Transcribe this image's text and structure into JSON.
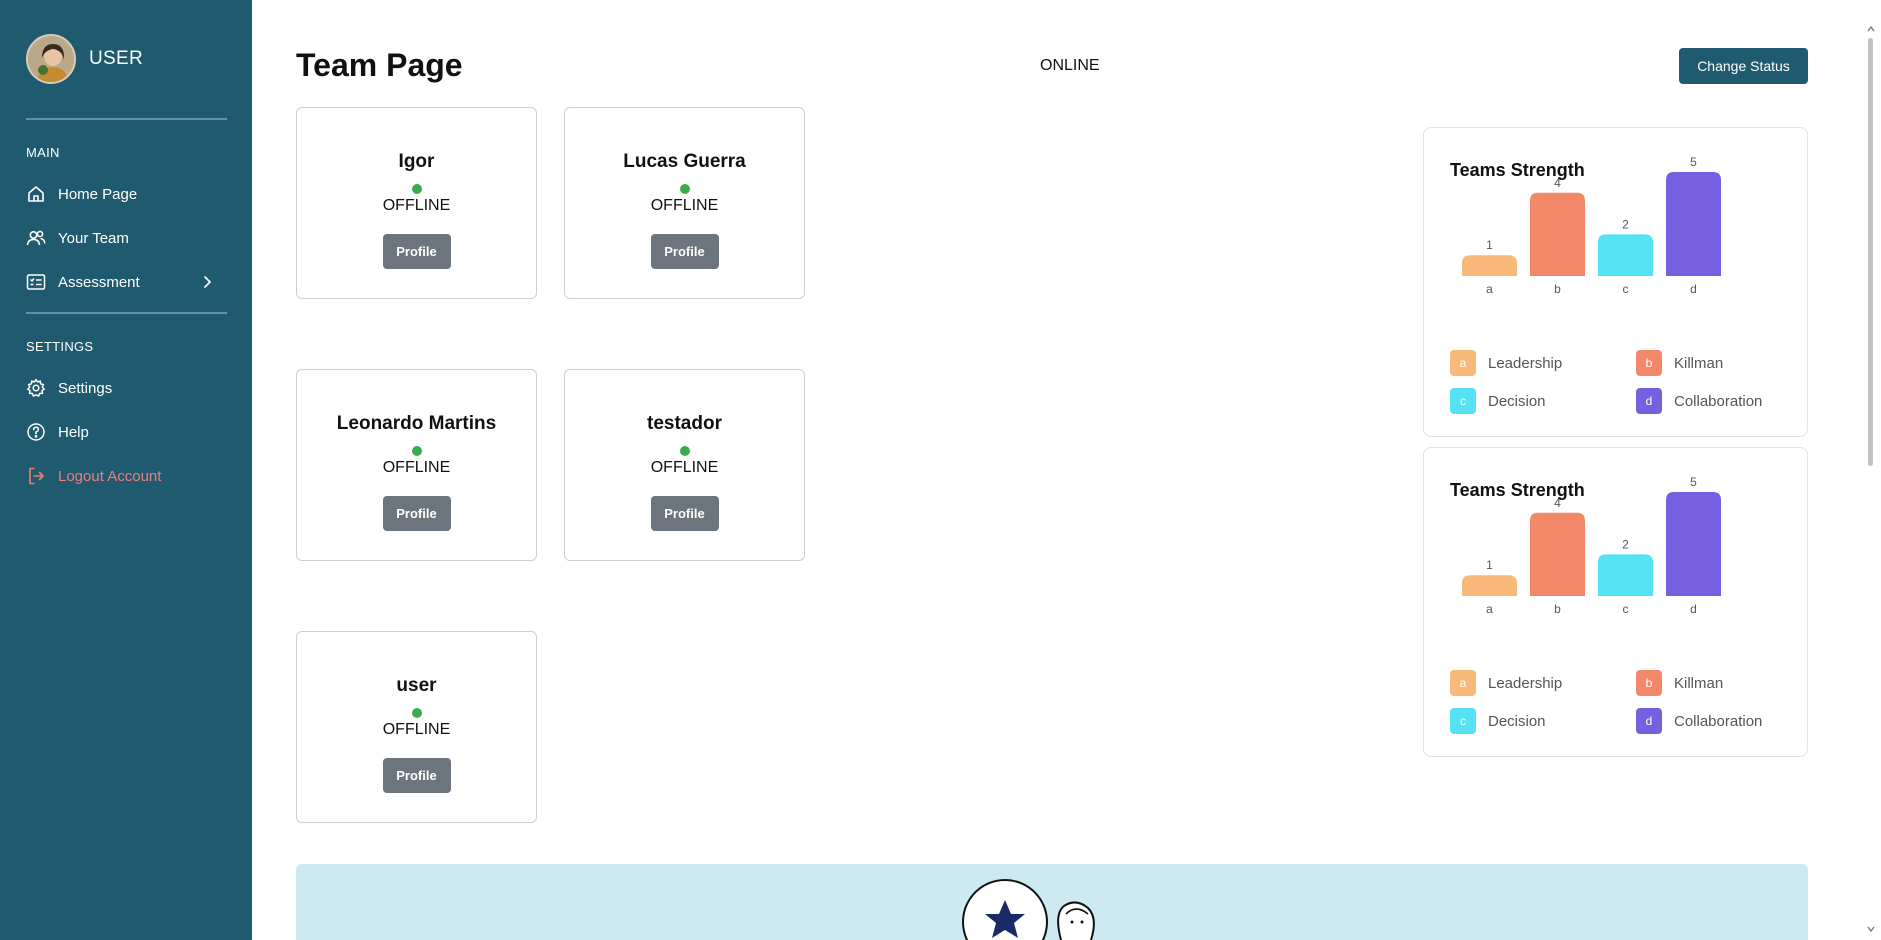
{
  "sidebar": {
    "user_label": "USER",
    "sections": {
      "main": "MAIN",
      "settings": "SETTINGS"
    },
    "items": [
      {
        "label": "Home Page",
        "icon": "home-icon"
      },
      {
        "label": "Your Team",
        "icon": "users-icon"
      },
      {
        "label": "Assessment",
        "icon": "checklist-icon"
      },
      {
        "label": "Settings",
        "icon": "gear-icon"
      },
      {
        "label": "Help",
        "icon": "help-icon"
      },
      {
        "label": "Logout Account",
        "icon": "logout-icon"
      }
    ]
  },
  "header": {
    "title": "Team Page",
    "status": "ONLINE",
    "change_status_label": "Change Status"
  },
  "members": [
    {
      "name": "Igor",
      "status": "OFFLINE",
      "button": "Profile"
    },
    {
      "name": "Lucas Guerra",
      "status": "OFFLINE",
      "button": "Profile"
    },
    {
      "name": "Leonardo Martins",
      "status": "OFFLINE",
      "button": "Profile"
    },
    {
      "name": "testador",
      "status": "OFFLINE",
      "button": "Profile"
    },
    {
      "name": "user",
      "status": "OFFLINE",
      "button": "Profile"
    }
  ],
  "colors": {
    "sidebar": "#1f5a6e",
    "online_dot": "#3cab4d",
    "logout": "#f07d76",
    "bar_a": "#f9b97a",
    "bar_b": "#f3876a",
    "bar_c": "#55e2f2",
    "bar_d": "#7760e0"
  },
  "chart_data": [
    {
      "type": "bar",
      "title": "Teams Strength",
      "categories": [
        "a",
        "b",
        "c",
        "d"
      ],
      "values": [
        1,
        4,
        2,
        5
      ],
      "ylim": [
        0,
        5
      ],
      "grid": false,
      "legend": [
        "Leadership",
        "Killman",
        "Decision",
        "Collaboration"
      ],
      "legend_placement": "bottom"
    },
    {
      "type": "bar",
      "title": "Teams Strength",
      "categories": [
        "a",
        "b",
        "c",
        "d"
      ],
      "values": [
        1,
        4,
        2,
        5
      ],
      "ylim": [
        0,
        5
      ],
      "grid": false,
      "legend": [
        "Leadership",
        "Killman",
        "Decision",
        "Collaboration"
      ],
      "legend_placement": "bottom"
    }
  ]
}
